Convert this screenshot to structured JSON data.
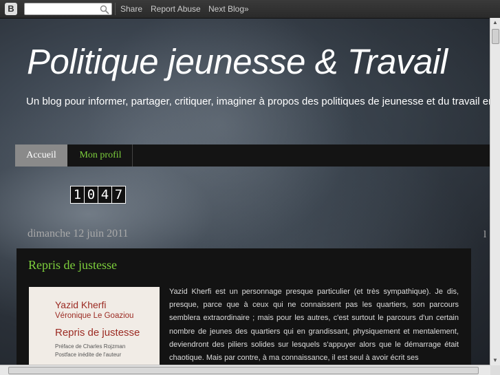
{
  "navbar": {
    "share": "Share",
    "report_abuse": "Report Abuse",
    "next_blog": "Next Blog»"
  },
  "header": {
    "title": "Politique jeunesse & Travail",
    "description": "Un blog pour informer, partager, critiquer, imaginer à propos des politiques de jeunesse et du travail en général. Avec un avis également sur les centres sociaux."
  },
  "tabs": [
    {
      "label": "Accueil",
      "active": true
    },
    {
      "label": "Mon profil",
      "active": false
    }
  ],
  "counter": [
    "1",
    "0",
    "4",
    "7"
  ],
  "post": {
    "date": "dimanche 12 juin 2011",
    "title": "Repris de justesse",
    "book": {
      "author": "Yazid Kherfi",
      "coauthor": "Véronique Le Goaziou",
      "title": "Repris de justesse",
      "preface": "Préface de Charles Rojzman",
      "postface": "Postface inédite de l'auteur"
    },
    "body": "Yazid Kherfi est un personnage presque particulier (et très sympathique). Je dis, presque, parce que à ceux qui ne connaissent pas les quartiers, son parcours semblera extraordinaire ; mais pour les autres, c'est surtout le parcours d'un certain nombre de jeunes des quartiers qui en grandissant, physiquement et mentalement, deviendront des piliers solides sur lesquels s'appuyer alors que le démarrage était chaotique. Mais par contre, à ma connaissance, il est seul à avoir écrit ses"
  },
  "colors": {
    "link_green": "#7dcf3c",
    "post_bg": "#131313",
    "tab_active_bg": "#8a8a8a"
  }
}
